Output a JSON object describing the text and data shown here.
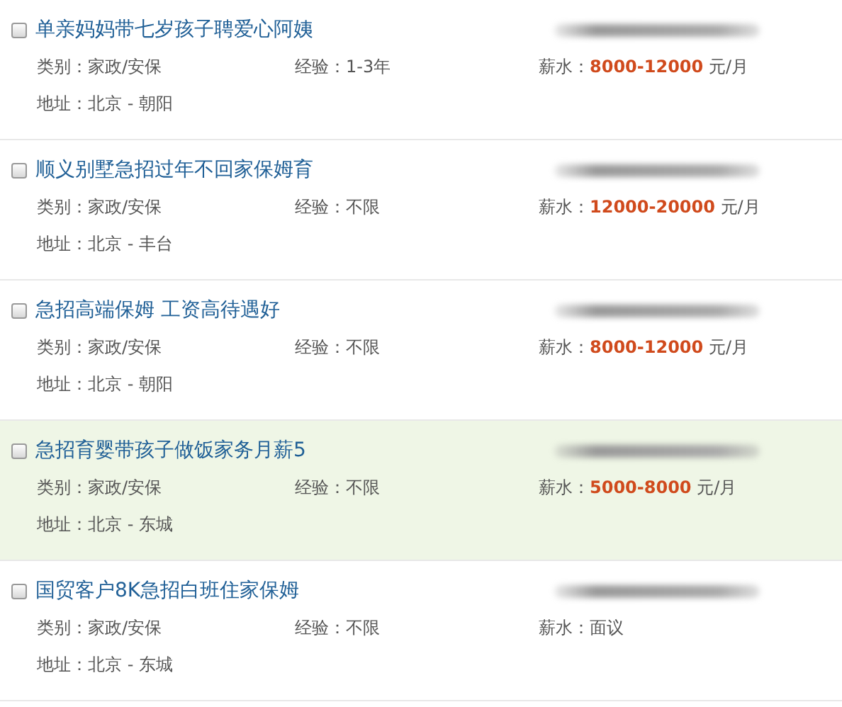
{
  "listings": [
    {
      "title": "单亲妈妈带七岁孩子聘爱心阿姨",
      "checked": false,
      "highlighted": false,
      "category_label": "类别：",
      "category": "家政/安保",
      "experience_label": "经验：",
      "experience": "1-3年",
      "salary_label": "薪水：",
      "salary": {
        "kind": "range",
        "amount": "8000-12000",
        "unit": "元/月"
      },
      "address_label": "地址：",
      "address": "北京 - 朝阳"
    },
    {
      "title": "顺义别墅急招过年不回家保姆育",
      "checked": false,
      "highlighted": false,
      "category_label": "类别：",
      "category": "家政/安保",
      "experience_label": "经验：",
      "experience": "不限",
      "salary_label": "薪水：",
      "salary": {
        "kind": "range",
        "amount": "12000-20000",
        "unit": "元/月"
      },
      "address_label": "地址：",
      "address": "北京 - 丰台"
    },
    {
      "title": "急招高端保姆 工资高待遇好",
      "checked": false,
      "highlighted": false,
      "category_label": "类别：",
      "category": "家政/安保",
      "experience_label": "经验：",
      "experience": "不限",
      "salary_label": "薪水：",
      "salary": {
        "kind": "range",
        "amount": "8000-12000",
        "unit": "元/月"
      },
      "address_label": "地址：",
      "address": "北京 - 朝阳"
    },
    {
      "title": "急招育婴带孩子做饭家务月薪5",
      "checked": false,
      "highlighted": true,
      "category_label": "类别：",
      "category": "家政/安保",
      "experience_label": "经验：",
      "experience": "不限",
      "salary_label": "薪水：",
      "salary": {
        "kind": "range",
        "amount": "5000-8000",
        "unit": "元/月"
      },
      "address_label": "地址：",
      "address": "北京 - 东城"
    },
    {
      "title": "国贸客户8K急招白班住家保姆",
      "checked": false,
      "highlighted": false,
      "category_label": "类别：",
      "category": "家政/安保",
      "experience_label": "经验：",
      "experience": "不限",
      "salary_label": "薪水：",
      "salary": {
        "kind": "text",
        "amount": "面议"
      },
      "address_label": "地址：",
      "address": "北京 - 东城"
    }
  ]
}
